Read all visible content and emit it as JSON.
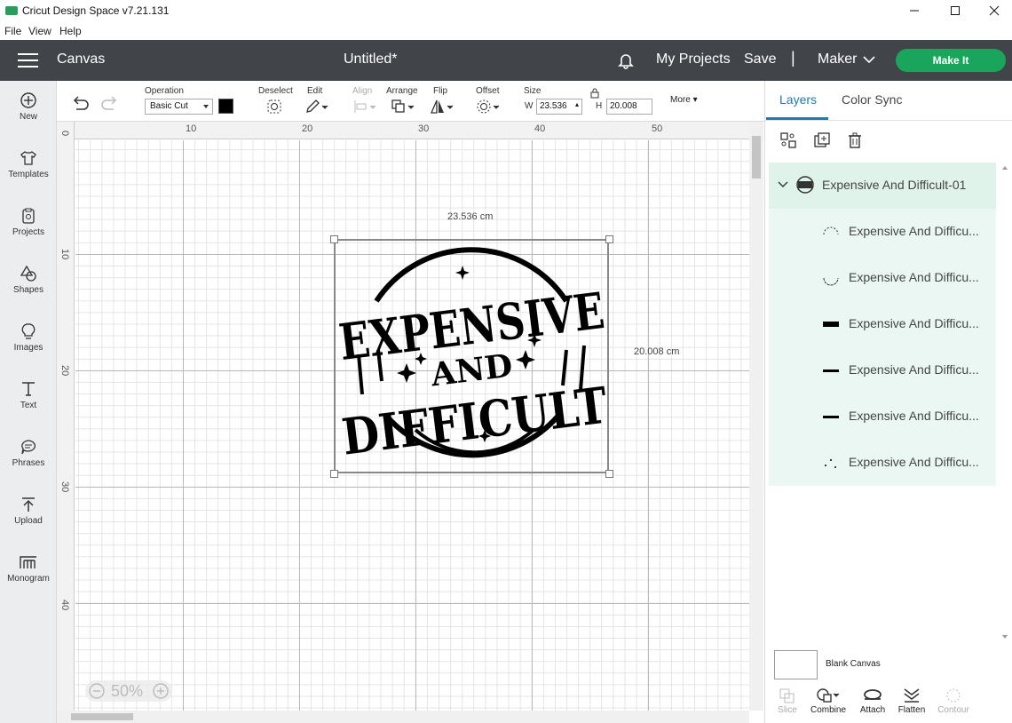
{
  "window": {
    "title": "Cricut Design Space  v7.21.131"
  },
  "menu": {
    "file": "File",
    "view": "View",
    "help": "Help"
  },
  "header": {
    "section": "Canvas",
    "doc_title": "Untitled*",
    "my_projects": "My Projects",
    "save": "Save",
    "separator": "|",
    "machine": "Maker",
    "make_it": "Make It"
  },
  "sidebar": {
    "items": [
      {
        "label": "New",
        "icon": "plus-circle-icon"
      },
      {
        "label": "Templates",
        "icon": "shirt-icon"
      },
      {
        "label": "Projects",
        "icon": "projects-icon"
      },
      {
        "label": "Shapes",
        "icon": "shapes-icon"
      },
      {
        "label": "Images",
        "icon": "lightbulb-icon"
      },
      {
        "label": "Text",
        "icon": "text-icon"
      },
      {
        "label": "Phrases",
        "icon": "speech-bubble-icon"
      },
      {
        "label": "Upload",
        "icon": "upload-icon"
      },
      {
        "label": "Monogram",
        "icon": "monogram-icon"
      }
    ]
  },
  "toolbar": {
    "operation_label": "Operation",
    "operation_value": "Basic Cut",
    "deselect": "Deselect",
    "edit": "Edit",
    "align": "Align",
    "arrange": "Arrange",
    "flip": "Flip",
    "offset": "Offset",
    "size": "Size",
    "w_label": "W",
    "w_value": "23.536",
    "h_label": "H",
    "h_value": "20.008",
    "more": "More"
  },
  "canvas": {
    "ruler_top": [
      "10",
      "20",
      "30",
      "40",
      "50"
    ],
    "ruler_left": [
      "0",
      "10",
      "20",
      "30",
      "40"
    ],
    "ruler_corner": "0",
    "width_label": "23.536 cm",
    "height_label": "20.008 cm",
    "zoom": "50%",
    "design_lines": [
      "EXPENSIVE",
      "AND",
      "DIFFICULT"
    ]
  },
  "right_panel": {
    "tabs": [
      "Layers",
      "Color Sync"
    ],
    "active_tab": "Layers",
    "group_name": "Expensive And Difficult-01",
    "layers": [
      "Expensive And Difficu...",
      "Expensive And Difficu...",
      "Expensive And Difficu...",
      "Expensive And Difficu...",
      "Expensive And Difficu...",
      "Expensive And Difficu..."
    ],
    "blank_canvas": "Blank Canvas",
    "bottom_tools": [
      "Slice",
      "Combine",
      "Attach",
      "Flatten",
      "Contour"
    ]
  },
  "colors": {
    "header_bg": "#414549",
    "accent": "#1aa55d",
    "tab_active": "#1a7fa8",
    "layers_bg": "#eaf7f2"
  }
}
